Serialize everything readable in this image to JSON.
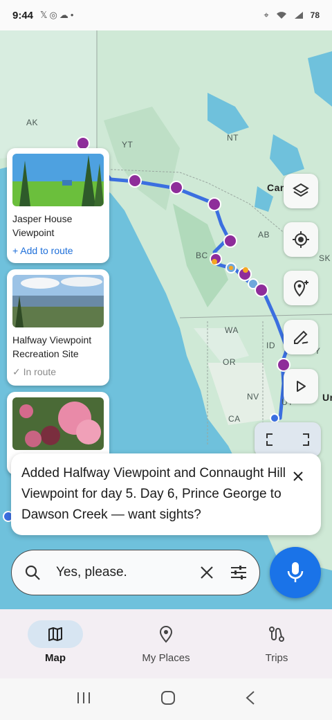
{
  "status_bar": {
    "time": "9:44",
    "battery": "78",
    "icons": [
      "x-logo-icon",
      "messenger-icon",
      "cloud-icon",
      "dot-icon",
      "location-icon",
      "wifi-icon",
      "signal-icon",
      "battery-icon"
    ]
  },
  "map": {
    "labels": {
      "ak": "AK",
      "yt": "YT",
      "nt": "NT",
      "canada": "Can",
      "bc": "BC",
      "ab": "AB",
      "sk": "SK",
      "wa": "WA",
      "or": "OR",
      "id": "ID",
      "wy": "WY",
      "nv": "NV",
      "ut": "UT",
      "ca": "CA",
      "us": "Ur"
    },
    "route_color": "#3b6fe0",
    "stop_color": "#8e2d9a",
    "water_color": "#6fc1dc",
    "land_color": "#cfe9d6"
  },
  "cards": [
    {
      "name": "Jasper House Viewpoint",
      "action": "+ Add to route"
    },
    {
      "name": "Halfway Viewpoint Recreation Site",
      "action": "✓ In route"
    },
    {
      "name": "",
      "action": ""
    }
  ],
  "controls": [
    "layers-icon",
    "my-location-icon",
    "add-place-icon",
    "draw-route-icon",
    "play-icon",
    "fit-bounds-icon"
  ],
  "message": {
    "text": "Added Halfway Viewpoint and Connaught Hill Viewpoint for day 5. Day 6, Prince George to Dawson Creek — want sights?"
  },
  "search": {
    "value": "Yes, please."
  },
  "bottom_nav": {
    "items": [
      {
        "label": "Map",
        "icon": "map-icon",
        "active": true
      },
      {
        "label": "My Places",
        "icon": "place-pin-icon",
        "active": false
      },
      {
        "label": "Trips",
        "icon": "route-icon",
        "active": false
      }
    ]
  }
}
